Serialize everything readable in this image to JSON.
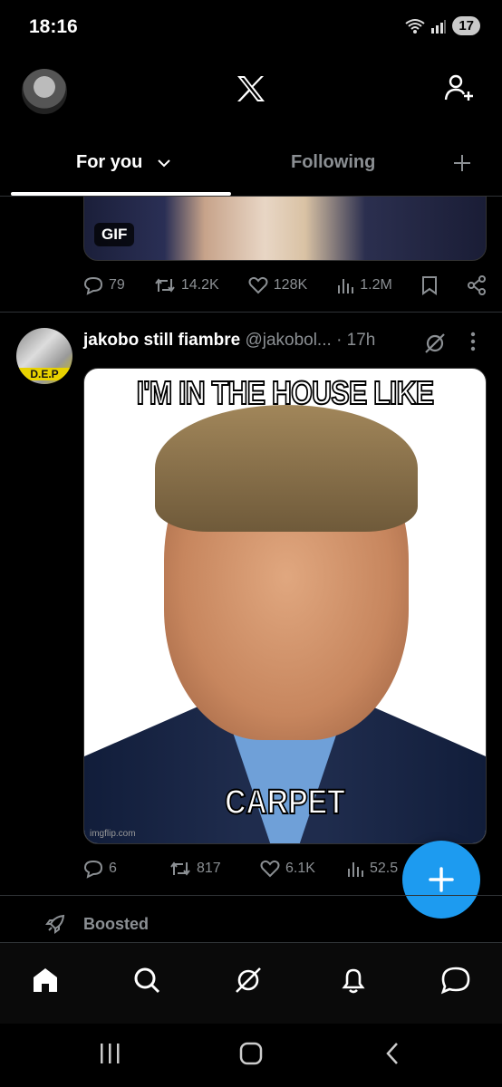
{
  "status_bar": {
    "time": "18:16",
    "battery": "17"
  },
  "tabs": {
    "for_you": "For you",
    "following": "Following"
  },
  "previous_post": {
    "gif_badge": "GIF",
    "replies": "79",
    "reposts": "14.2K",
    "likes": "128K",
    "views": "1.2M"
  },
  "post": {
    "display_name": "jakobo still fiambre",
    "handle": "@jakobol...",
    "time": "· 17h",
    "avatar_label": "D.E.P",
    "meme_top": "I'M IN THE HOUSE LIKE",
    "meme_bottom": "CARPET",
    "watermark": "imgflip.com",
    "replies": "6",
    "reposts": "817",
    "likes": "6.1K",
    "views": "52.5"
  },
  "boosted_label": "Boosted",
  "colors": {
    "accent": "#1d9bf0",
    "background": "#000000",
    "muted": "#8b8f93"
  }
}
